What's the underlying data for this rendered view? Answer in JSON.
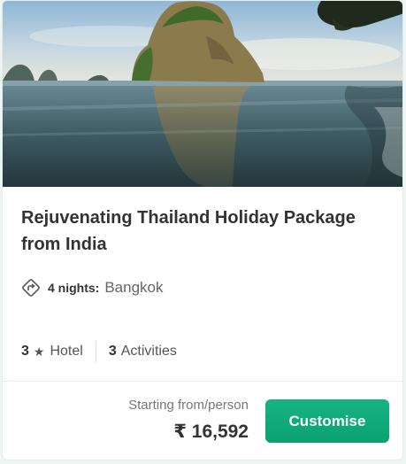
{
  "package": {
    "title": "Rejuvenating Thailand Holiday Package from India",
    "duration": "4 nights:",
    "city": "Bangkok",
    "hotel_count": "3",
    "hotel_label": "Hotel",
    "activity_count": "3",
    "activity_label": "Activities",
    "price_caption": "Starting from/person",
    "price": "₹ 16,592",
    "cta_label": "Customise"
  },
  "icons": {
    "duration": "route-icon",
    "hotel": "star-icon"
  },
  "colors": {
    "cta_start": "#16b383",
    "cta_end": "#0aa26f",
    "text_dark": "#333333",
    "text_muted": "#777777"
  }
}
